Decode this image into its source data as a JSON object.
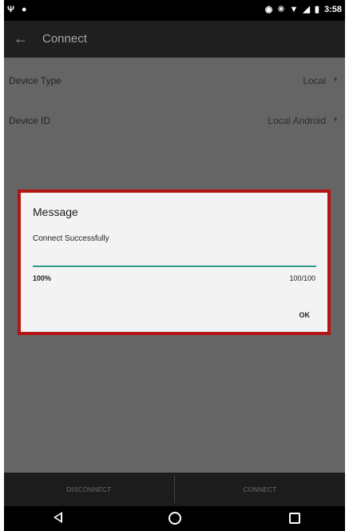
{
  "status_bar": {
    "left_icons": [
      "usb-icon",
      "notification-pin-icon"
    ],
    "right_icons": [
      "location-icon",
      "bluetooth-icon",
      "wifi-icon",
      "signal-icon",
      "battery-icon"
    ],
    "time": "3:58"
  },
  "app_bar": {
    "title": "Connect"
  },
  "settings": {
    "device_type": {
      "label": "Device Type",
      "value": "Local"
    },
    "device_id": {
      "label": "Device ID",
      "value": "Local Android"
    }
  },
  "dialog": {
    "title": "Message",
    "message": "Connect Successfully",
    "progress_fraction": 1.0,
    "progress_percent_text": "100%",
    "progress_count_text": "100/100",
    "ok_label": "OK",
    "progress_color": "#2f9c8a",
    "highlight_border_color": "#b31515"
  },
  "buttons": {
    "disconnect": "DISCONNECT",
    "connect": "CONNECT"
  }
}
